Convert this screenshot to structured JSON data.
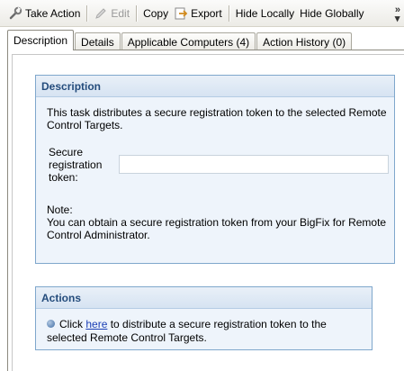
{
  "toolbar": {
    "take_action": "Take Action",
    "edit": "Edit",
    "copy": "Copy",
    "export": "Export",
    "hide_locally": "Hide Locally",
    "hide_globally": "Hide Globally",
    "overflow_icon": "chevron-double-right"
  },
  "tabs": [
    {
      "label": "Description",
      "active": true
    },
    {
      "label": "Details"
    },
    {
      "label": "Applicable Computers (4)"
    },
    {
      "label": "Action History (0)"
    }
  ],
  "description": {
    "heading": "Description",
    "text": "This task distributes a secure registration token to the selected Remote Control Targets.",
    "field_label": "Secure registration token:",
    "field_value": "",
    "note_label": "Note:",
    "note_text": "You can obtain a secure registration token from your BigFix for Remote Control Administrator."
  },
  "actions": {
    "heading": "Actions",
    "prefix": "Click",
    "link": "here",
    "suffix": "to distribute a secure registration token to the selected Remote Control Targets."
  },
  "colors": {
    "section_border": "#7fa7cc",
    "section_background": "#eef4fb",
    "heading_text": "#244c7c",
    "link": "#1a3fb5"
  }
}
